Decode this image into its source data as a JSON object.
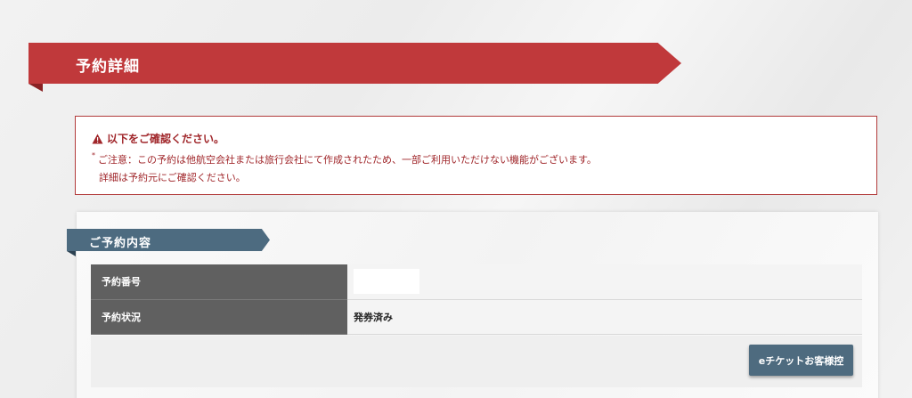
{
  "header": {
    "title": "予約詳細"
  },
  "alert": {
    "title": "以下をご確認ください。",
    "mark": "*",
    "line1": "ご注意：この予約は他航空会社または旅行会社にて作成されたため、一部ご利用いただけない機能がございます。",
    "line2": "詳細は予約元にご確認ください。",
    "icon": "warning-icon",
    "color": "#a0262a"
  },
  "section": {
    "title": "ご予約内容",
    "rows": [
      {
        "label": "予約番号",
        "value": ""
      },
      {
        "label": "予約状況",
        "value": "発券済み"
      }
    ]
  },
  "actions": {
    "eticket_label": "eチケットお客様控"
  },
  "colors": {
    "header_red": "#c0393b",
    "section_blue": "#4d6b80",
    "table_header": "#606060"
  }
}
